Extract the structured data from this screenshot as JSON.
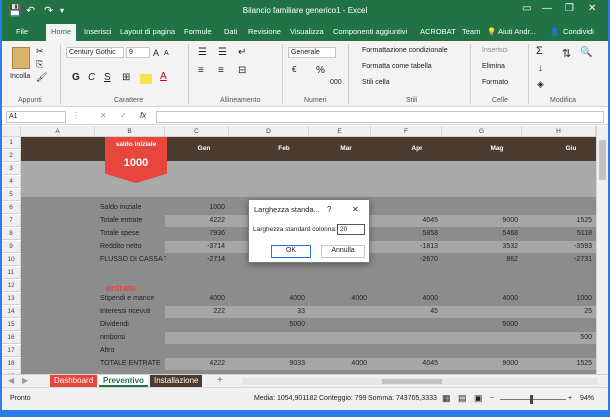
{
  "window": {
    "title": "Bilancio familiare generico1 - Excel",
    "restore": "❐",
    "minimize": "—",
    "close": "✕",
    "options": "▭"
  },
  "quick_access": {
    "save": "💾",
    "undo": "↶",
    "redo": "↷",
    "more": "▾"
  },
  "tabs": [
    "File",
    "Home",
    "Inserisci",
    "Layout di pagina",
    "Formule",
    "Dati",
    "Revisione",
    "Visualizza",
    "Componenti aggiuntivi",
    "ACROBAT",
    "Team"
  ],
  "tell_me": "Aiuti Andr...",
  "share": "Condividi",
  "ribbon": {
    "clipboard": {
      "paste": "Incolla",
      "group": "Appunti"
    },
    "font": {
      "name": "Century Gothic",
      "size": "9",
      "bold": "G",
      "italic": "C",
      "underline": "S",
      "grow": "A",
      "shrink": "A",
      "group": "Carattere"
    },
    "alignment": {
      "group": "Allineamento"
    },
    "number": {
      "format": "Generale",
      "percent": "%",
      "thousands": "000",
      "currency": "€",
      "group": "Numeri"
    },
    "styles": {
      "conditional": "Formattazione condizionale",
      "table": "Formatta come tabella",
      "cell": "Stili cella",
      "group": "Stili"
    },
    "cells": {
      "insert": "Inserisci",
      "delete": "Elimina",
      "format": "Formato",
      "group": "Celle"
    },
    "editing": {
      "sum": "Σ",
      "fill": "↓",
      "clear": "◈",
      "sort": "⇅",
      "find": "🔍",
      "group": "Modifica"
    }
  },
  "formula_bar": {
    "name_box": "A1",
    "fx": "fx",
    "value": ""
  },
  "columns": [
    "A",
    "B",
    "C",
    "D",
    "E",
    "F",
    "G",
    "H"
  ],
  "rows": [
    "1",
    "2",
    "3",
    "4",
    "5",
    "6",
    "7",
    "8",
    "9",
    "10",
    "11",
    "12",
    "13",
    "14",
    "15",
    "16",
    "17",
    "18",
    "19"
  ],
  "sheet": {
    "header_months": [
      "Gen",
      "Feb",
      "Mar",
      "Apr",
      "Mag",
      "Giu"
    ],
    "saldo_badge": {
      "label": "saldo iniziale",
      "value": "1000"
    },
    "section1": [
      {
        "label": "Saldo iniziale",
        "vals": [
          "1000",
          "",
          "",
          "",
          "",
          ""
        ]
      },
      {
        "label": "Totale entrate",
        "vals": [
          "4222",
          "",
          "",
          "4045",
          "9000",
          "1525"
        ]
      },
      {
        "label": "Totale spese",
        "vals": [
          "7936",
          "",
          "",
          "5858",
          "5468",
          "5118"
        ]
      },
      {
        "label": "Reddito netto",
        "vals": [
          "-3714",
          "",
          "",
          "-1813",
          "3532",
          "-3593"
        ]
      },
      {
        "label": "FLUSSO DI CASSA TO",
        "vals": [
          "-2714",
          "",
          "",
          "-2670",
          "862",
          "-2731"
        ]
      }
    ],
    "entrate_title": "entrate",
    "section2": [
      {
        "label": "Stipendi e mance",
        "vals": [
          "4000",
          "4000",
          "4000",
          "4000",
          "4000",
          "1000"
        ]
      },
      {
        "label": "Interessi ricevuti",
        "vals": [
          "222",
          "33",
          "",
          "45",
          "",
          "25"
        ]
      },
      {
        "label": "Dividendi",
        "vals": [
          "",
          "5000",
          "",
          "",
          "5000",
          ""
        ]
      },
      {
        "label": "rimborsi",
        "vals": [
          "",
          "",
          "",
          "",
          "",
          "500"
        ]
      },
      {
        "label": "Altro",
        "vals": [
          "",
          "",
          "",
          "",
          "",
          ""
        ]
      },
      {
        "label": "TOTALE ENTRATE",
        "vals": [
          "4222",
          "9033",
          "4000",
          "4045",
          "9000",
          "1525"
        ]
      }
    ]
  },
  "dialog": {
    "title": "Larghezza standa...",
    "help": "?",
    "close": "✕",
    "label": "Larghezza standard colonna:",
    "value": "20",
    "ok": "OK",
    "cancel": "Annulla"
  },
  "sheet_tabs": [
    "Dashboard",
    "Preventivo",
    "Installazione"
  ],
  "add_sheet": "+",
  "status": {
    "ready": "Pronto",
    "media": "Media: 1054,901182",
    "count": "Conteggio: 799",
    "sum": "Somma: 743705,3333",
    "zoom": "94%"
  },
  "colors": {
    "excel_green": "#217346",
    "brown": "#4b3a2e",
    "red": "#e8453c",
    "gray_band": "#7f7f7f",
    "dark_band": "#6b6b6b"
  }
}
